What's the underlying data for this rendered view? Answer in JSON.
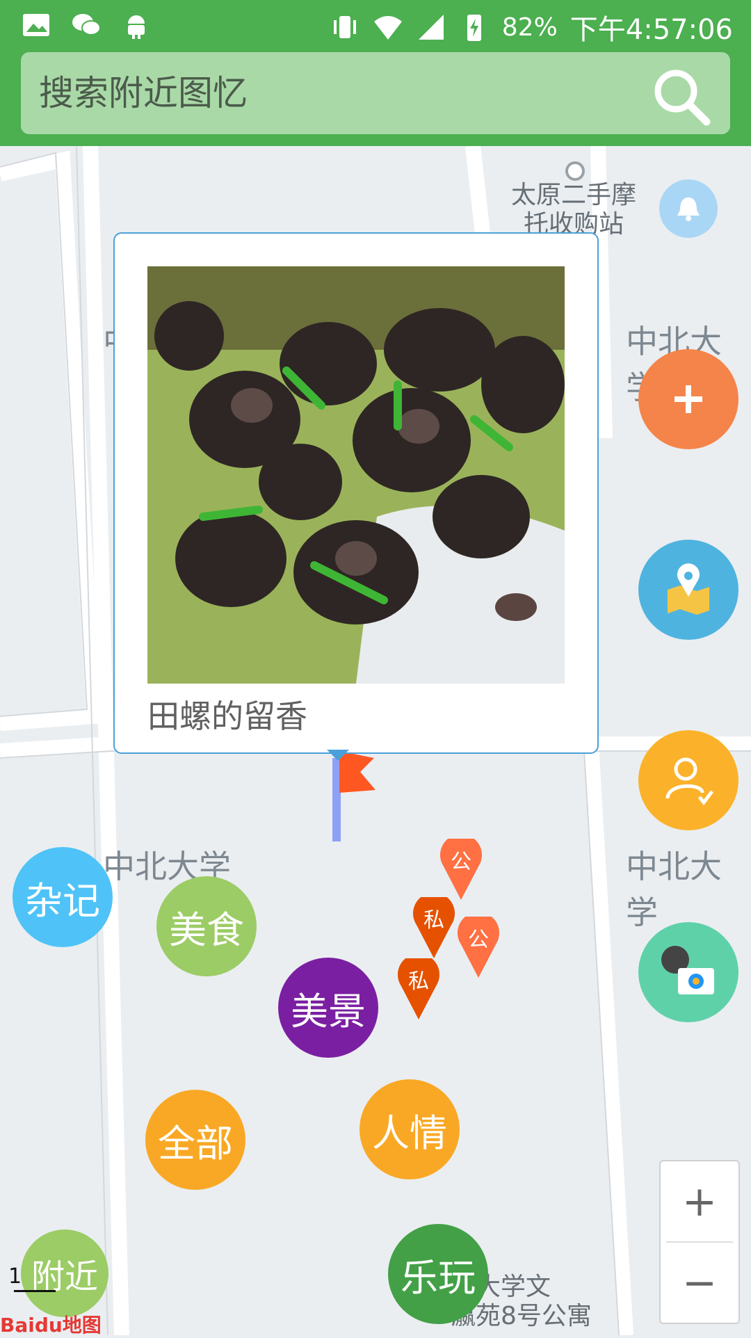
{
  "status_bar": {
    "battery_percent": "82%",
    "time": "下午4:57:06",
    "icons": [
      "image-icon",
      "wechat-icon",
      "android-icon",
      "vibrate-icon",
      "wifi-icon",
      "signal-icon",
      "battery-charging-icon"
    ]
  },
  "search": {
    "placeholder": "搜索附近图忆",
    "button_icon": "search-icon"
  },
  "map": {
    "labels": {
      "poi_top": "太原二手摩\n托收购站",
      "campus_left_mid": "中北大学",
      "campus_right_top": "中北大学",
      "campus_right_mid": "中北大学",
      "bottom_right": "北大学文\n瀛苑8号公寓"
    },
    "scale_value": "1",
    "brand": "Baidu地图"
  },
  "popup": {
    "caption": "田螺的留香",
    "image_desc_icon": "snail-dish-photo"
  },
  "pins": [
    {
      "label": "公",
      "color": "#ff7043"
    },
    {
      "label": "私",
      "color": "#e65100"
    },
    {
      "label": "公",
      "color": "#ff7043"
    },
    {
      "label": "私",
      "color": "#e65100"
    }
  ],
  "fabs": {
    "add": {
      "icon": "plus-icon",
      "color": "#f5844a"
    },
    "map": {
      "icon": "map-pin-icon",
      "color": "#4fb3e0"
    },
    "user": {
      "icon": "user-check-icon",
      "color": "#fbb22a"
    },
    "camera": {
      "icon": "camera-icon",
      "color": "#5fd1a8"
    },
    "bell": {
      "icon": "bell-icon",
      "color": "#a9d6f5"
    }
  },
  "categories": [
    {
      "label": "杂记",
      "color": "#4fc3f7"
    },
    {
      "label": "美食",
      "color": "#9ccc65"
    },
    {
      "label": "美景",
      "color": "#7b1fa2"
    },
    {
      "label": "全部",
      "color": "#f9a825"
    },
    {
      "label": "人情",
      "color": "#f9a825"
    },
    {
      "label": "附近",
      "color": "#9ccc65"
    },
    {
      "label": "乐玩",
      "color": "#43a047"
    }
  ],
  "zoom": {
    "in_label": "+",
    "out_label": "−"
  }
}
